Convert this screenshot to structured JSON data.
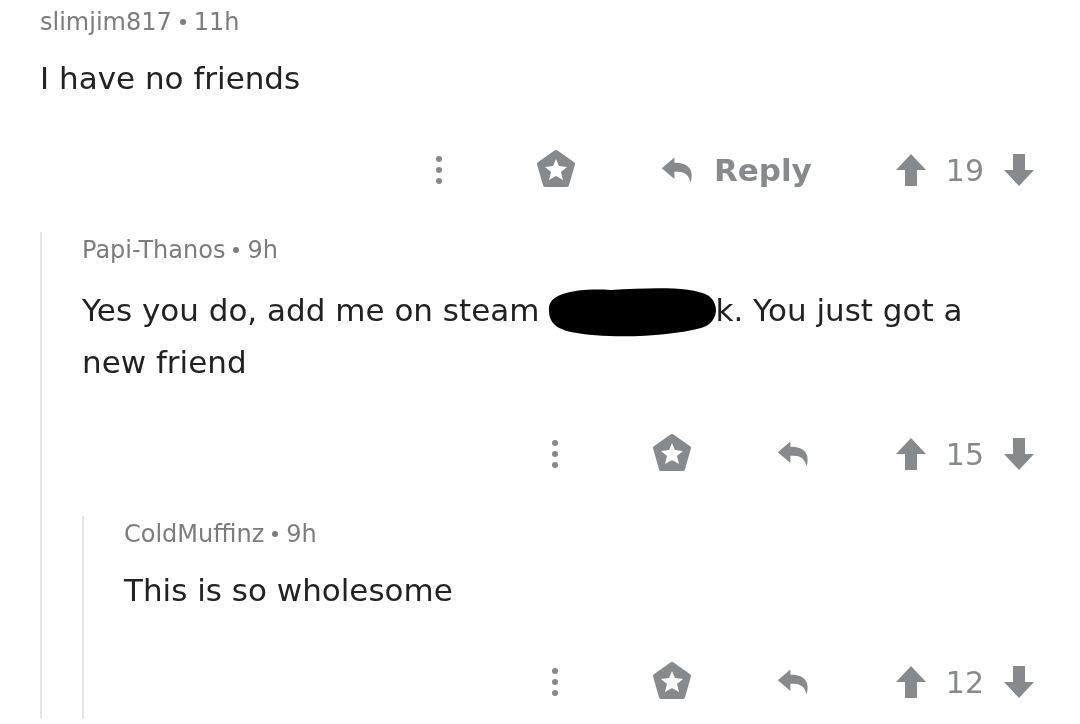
{
  "comments": [
    {
      "author": "slimjim817",
      "age": "11h",
      "body": "I have no friends",
      "reply_label": "Reply",
      "score": "19",
      "children": [
        {
          "author": "Papi-Thanos",
          "age": "9h",
          "body": "Yes you do, add me on steam",
          "redacted": true,
          "body_after": "k. You just got a",
          "body_tail": "new friend",
          "score": "15",
          "children": [
            {
              "author": "ColdMuffinz",
              "age": "9h",
              "body": "This is so wholesome",
              "score": "12"
            }
          ]
        }
      ]
    }
  ]
}
